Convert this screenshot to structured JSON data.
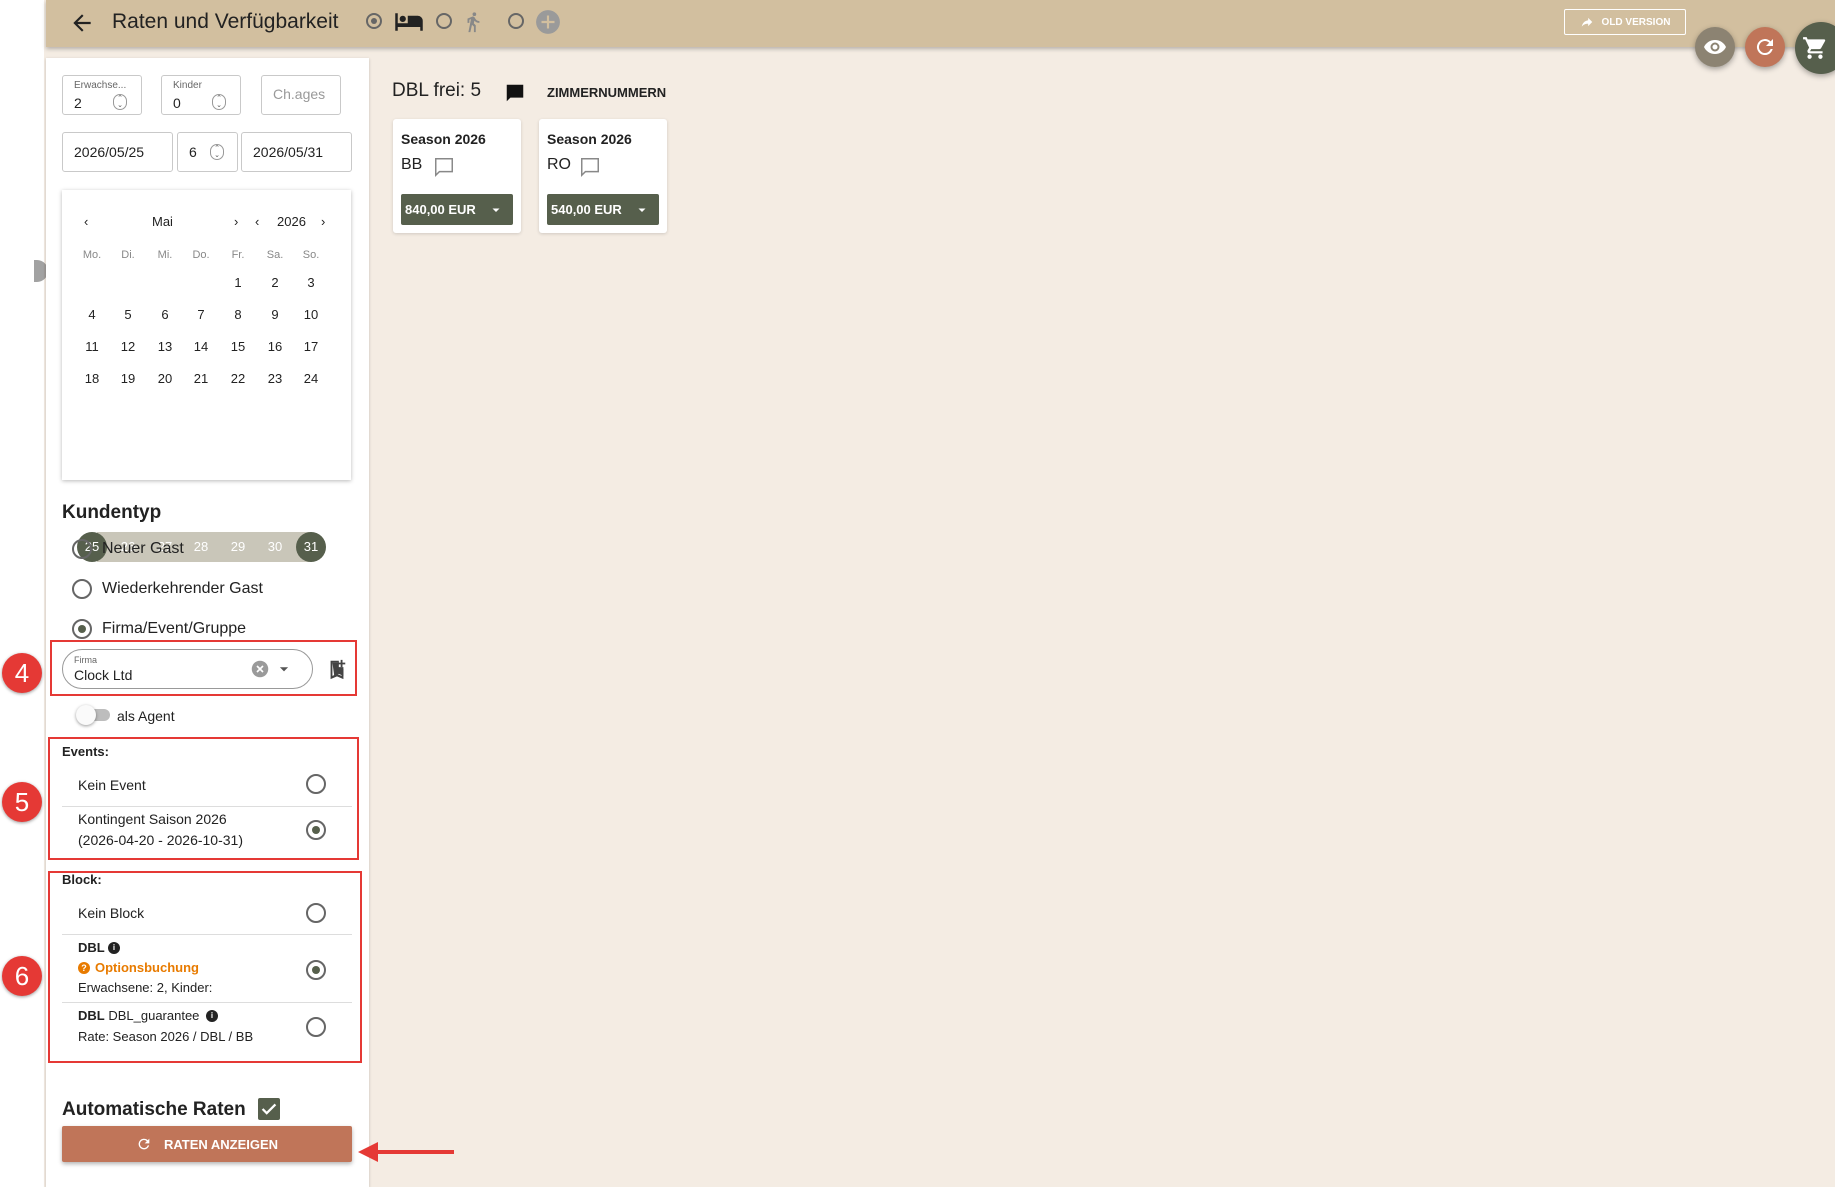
{
  "header": {
    "title": "Raten und Verfügbarkeit",
    "old_version": "OLD VERSION"
  },
  "search": {
    "adults_label": "Erwachse...",
    "adults_value": "2",
    "children_label": "Kinder",
    "children_value": "0",
    "ch_ages_placeholder": "Ch.ages",
    "arrival": "2026/05/25",
    "nights": "6",
    "departure": "2026/05/31"
  },
  "calendar": {
    "month": "Mai",
    "year": "2026",
    "weekdays": [
      "Mo.",
      "Di.",
      "Mi.",
      "Do.",
      "Fr.",
      "Sa.",
      "So."
    ],
    "weeks": [
      [
        "",
        "",
        "",
        "",
        "1",
        "2",
        "3"
      ],
      [
        "4",
        "5",
        "6",
        "7",
        "8",
        "9",
        "10"
      ],
      [
        "11",
        "12",
        "13",
        "14",
        "15",
        "16",
        "17"
      ],
      [
        "18",
        "19",
        "20",
        "21",
        "22",
        "23",
        "24"
      ],
      [
        "25",
        "26",
        "27",
        "28",
        "29",
        "30",
        "31"
      ]
    ]
  },
  "customer": {
    "heading": "Kundentyp",
    "options": [
      "Neuer Gast",
      "Wiederkehrender Gast",
      "Firma/Event/Gruppe"
    ],
    "company_label": "Firma",
    "company_value": "Clock Ltd",
    "agent_label": "als Agent"
  },
  "events": {
    "heading": "Events:",
    "none": "Kein Event",
    "item_line1": "Kontingent Saison 2026",
    "item_line2": "(2026-04-20 - 2026-10-31)"
  },
  "block": {
    "heading": "Block:",
    "none": "Kein Block",
    "dbl_title": "DBL",
    "dbl_option": "Optionsbuchung",
    "dbl_persons": "Erwachsene: 2, Kinder:",
    "guar_title_bold": "DBL",
    "guar_title_rest": "DBL_guarantee",
    "guar_rate": "Rate: Season 2026 / DBL / BB"
  },
  "auto_rates": {
    "label": "Automatische Raten",
    "button": "RATEN ANZEIGEN"
  },
  "annotations": [
    "4",
    "5",
    "6"
  ],
  "results": {
    "title": "DBL frei: 5",
    "room_numbers": "ZIMMERNUMMERN",
    "cards": [
      {
        "season": "Season 2026",
        "board": "BB",
        "price": "840,00 EUR"
      },
      {
        "season": "Season 2026",
        "board": "RO",
        "price": "540,00 EUR"
      }
    ]
  },
  "colors": {
    "header": "#d2bf9f",
    "background": "#f4ece3",
    "accent_green": "#565f4c",
    "accent_rust": "#c07559",
    "annotation_red": "#e53935",
    "option_orange": "#e87b00"
  }
}
